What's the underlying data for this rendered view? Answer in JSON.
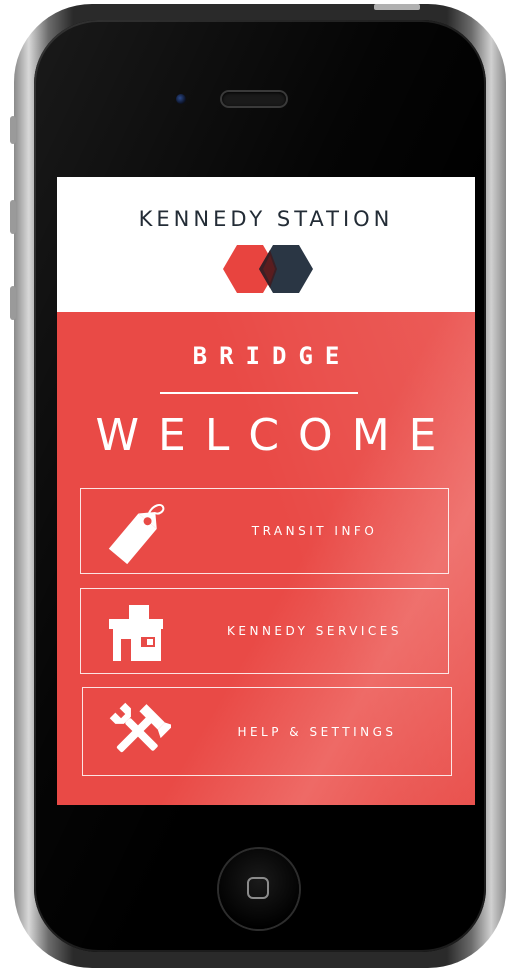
{
  "header": {
    "station_name": "KENNEDY STATION"
  },
  "main": {
    "brand": "BRIDGE",
    "welcome": "WELCOME"
  },
  "menu": [
    {
      "label": "TRANSIT INFO",
      "icon": "tag-icon"
    },
    {
      "label": "KENNEDY SERVICES",
      "icon": "building-icon"
    },
    {
      "label": "HELP & SETTINGS",
      "icon": "tools-icon"
    }
  ],
  "colors": {
    "accent_red": "#e84b47",
    "dark_navy": "#232c36",
    "logo_red": "#e8443f",
    "logo_dark": "#2a3644"
  }
}
